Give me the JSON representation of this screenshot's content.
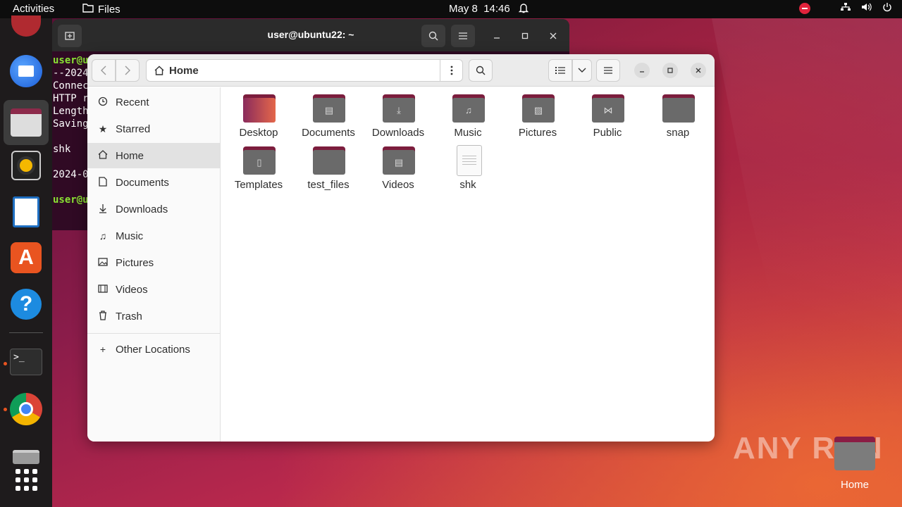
{
  "topbar": {
    "activities": "Activities",
    "app_name": "Files",
    "date": "May 8",
    "time": "14:46"
  },
  "terminal": {
    "title": "user@ubuntu22: ~",
    "lines": [
      "user@u",
      "--2024",
      "Connec",
      "HTTP r",
      "Length",
      "Saving",
      "",
      "shk",
      "",
      "2024-0",
      "",
      "user@u"
    ]
  },
  "files": {
    "location": "Home",
    "sidebar": [
      {
        "label": "Recent",
        "icon": "clock-icon"
      },
      {
        "label": "Starred",
        "icon": "star-icon"
      },
      {
        "label": "Home",
        "icon": "home-icon",
        "active": true
      },
      {
        "label": "Documents",
        "icon": "document-icon"
      },
      {
        "label": "Downloads",
        "icon": "download-icon"
      },
      {
        "label": "Music",
        "icon": "music-icon"
      },
      {
        "label": "Pictures",
        "icon": "picture-icon"
      },
      {
        "label": "Videos",
        "icon": "video-icon"
      },
      {
        "label": "Trash",
        "icon": "trash-icon"
      },
      {
        "label": "Other Locations",
        "icon": "plus-icon"
      }
    ],
    "items": [
      {
        "label": "Desktop",
        "type": "folder"
      },
      {
        "label": "Documents",
        "type": "folder"
      },
      {
        "label": "Downloads",
        "type": "folder"
      },
      {
        "label": "Music",
        "type": "folder"
      },
      {
        "label": "Pictures",
        "type": "folder"
      },
      {
        "label": "Public",
        "type": "folder"
      },
      {
        "label": "snap",
        "type": "folder"
      },
      {
        "label": "Templates",
        "type": "folder"
      },
      {
        "label": "test_files",
        "type": "folder"
      },
      {
        "label": "Videos",
        "type": "folder"
      },
      {
        "label": "shk",
        "type": "file"
      }
    ]
  },
  "desktop": {
    "home_label": "Home",
    "watermark": "ANY RUN"
  }
}
